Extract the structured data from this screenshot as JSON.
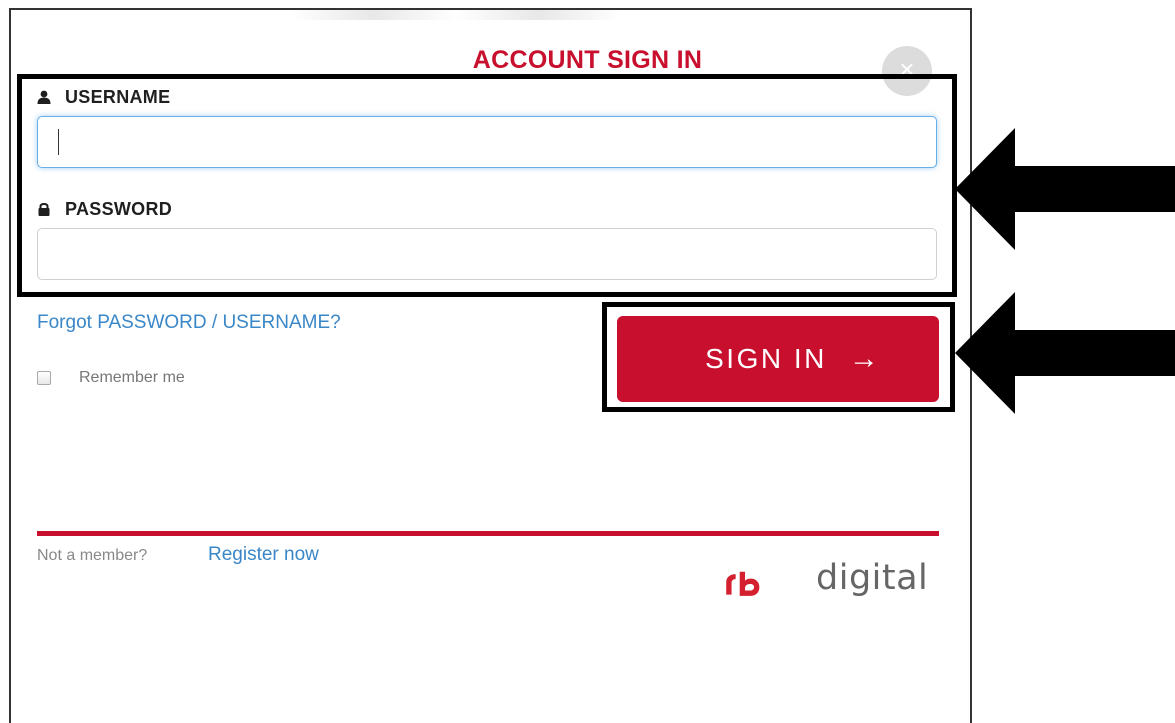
{
  "dialog": {
    "title": "ACCOUNT SIGN IN",
    "close_icon_glyph": "×"
  },
  "form": {
    "username_label": "USERNAME",
    "username_value": "",
    "password_label": "PASSWORD",
    "password_value": "",
    "forgot_link": "Forgot PASSWORD / USERNAME?",
    "remember_label": "Remember me",
    "remember_checked": false,
    "signin_label": "SIGN IN",
    "signin_arrow": "→"
  },
  "footer": {
    "not_member_text": "Not a member?",
    "register_link": "Register now",
    "logo_text": "digital"
  },
  "icons": {
    "user": "user-icon",
    "lock": "lock-icon",
    "close": "close-icon",
    "arrow_right": "arrow-right-icon",
    "pointer_arrow": "left-arrow-icon"
  },
  "colors": {
    "brand_red": "#c8102e",
    "link_blue": "#3a87c8",
    "focus_blue": "#66afe9",
    "highlight_black": "#000000"
  }
}
